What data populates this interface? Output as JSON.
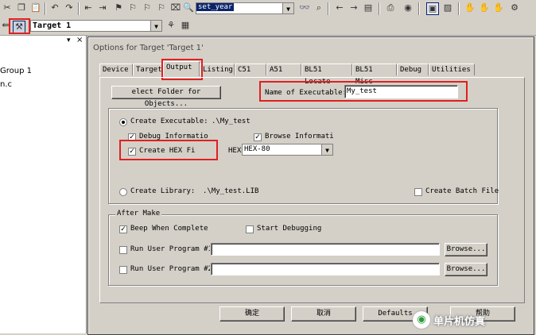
{
  "toolbar": {
    "find_combo_value": "set_year"
  },
  "toolbar2": {
    "target_combo_value": "Target 1"
  },
  "leftpane": {
    "close_glyph": "×",
    "group_label": "Group 1",
    "file_label": "n.c"
  },
  "dialog": {
    "title": "Options for Target 'Target 1'",
    "tabs": [
      {
        "label": "Device",
        "active": false
      },
      {
        "label": "Target",
        "active": false
      },
      {
        "label": "Output",
        "active": true
      },
      {
        "label": "Listing",
        "active": false
      },
      {
        "label": "C51",
        "active": false
      },
      {
        "label": "A51",
        "active": false
      },
      {
        "label": "BL51 Locate",
        "active": false
      },
      {
        "label": "BL51 Misc",
        "active": false
      },
      {
        "label": "Debug",
        "active": false
      },
      {
        "label": "Utilities",
        "active": false
      }
    ],
    "select_folder_label": "elect Folder for Objects...",
    "name_exe_label": "Name of Executable:",
    "name_exe_value": "My_test",
    "create_exe_label": "Create Executable:",
    "create_exe_path": ".\\My_test",
    "create_exe_selected": true,
    "debug_info_label": "Debug Informatio",
    "debug_info_checked": true,
    "browse_info_label": "Browse Informati",
    "browse_info_checked": true,
    "create_hex_label": "Create HEX Fi",
    "create_hex_checked": true,
    "hex_label": "HEX",
    "hex_value": "HEX-80",
    "create_lib_label": "Create Library:",
    "create_lib_path": ".\\My_test.LIB",
    "create_lib_selected": false,
    "create_batch_label": "Create Batch File",
    "create_batch_checked": false,
    "after_make_title": "After Make",
    "beep_label": "Beep When Complete",
    "beep_checked": true,
    "start_debug_label": "Start Debugging",
    "start_debug_checked": false,
    "run_prog1_label": "Run User Program #1",
    "run_prog1_checked": false,
    "run_prog2_label": "Run User Program #2",
    "run_prog2_checked": false,
    "browse_label": "Browse...",
    "ok_label": "确定",
    "cancel_label": "取消",
    "defaults_label": "Defaults",
    "help_label": "帮助",
    "check_glyph": "✓",
    "dropdown_glyph": "▼"
  },
  "watermark": {
    "text": "单片机仿真"
  },
  "colors": {
    "highlight_box": "#e02020",
    "selection": "#0a246a",
    "face": "#d4d0c8"
  }
}
